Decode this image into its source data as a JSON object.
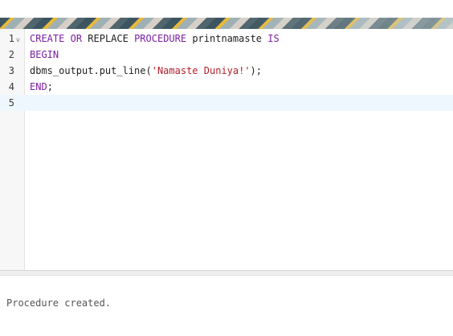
{
  "editor": {
    "lines": [
      {
        "number": "1",
        "parts": [
          {
            "text": "CREATE",
            "kind": "kw"
          },
          {
            "text": " ",
            "kind": "plain"
          },
          {
            "text": "OR",
            "kind": "kw"
          },
          {
            "text": " REPLACE ",
            "kind": "plain"
          },
          {
            "text": "PROCEDURE",
            "kind": "kw"
          },
          {
            "text": " printnamaste ",
            "kind": "plain"
          },
          {
            "text": "IS",
            "kind": "kw"
          }
        ]
      },
      {
        "number": "2",
        "parts": [
          {
            "text": "BEGIN",
            "kind": "kw"
          }
        ]
      },
      {
        "number": "3",
        "parts": [
          {
            "text": "dbms_output.put_line(",
            "kind": "plain"
          },
          {
            "text": "'Namaste Duniya!'",
            "kind": "str"
          },
          {
            "text": ");",
            "kind": "plain"
          }
        ]
      },
      {
        "number": "4",
        "parts": [
          {
            "text": "END",
            "kind": "kw"
          },
          {
            "text": ";",
            "kind": "plain"
          }
        ]
      },
      {
        "number": "5",
        "parts": []
      }
    ],
    "fold_glyph": "v",
    "active_line": "5"
  },
  "output": {
    "message": "Procedure created."
  },
  "colors": {
    "keyword": "#7a1fa3",
    "string": "#b3202a",
    "active_line_bg": "#eef7fd"
  }
}
